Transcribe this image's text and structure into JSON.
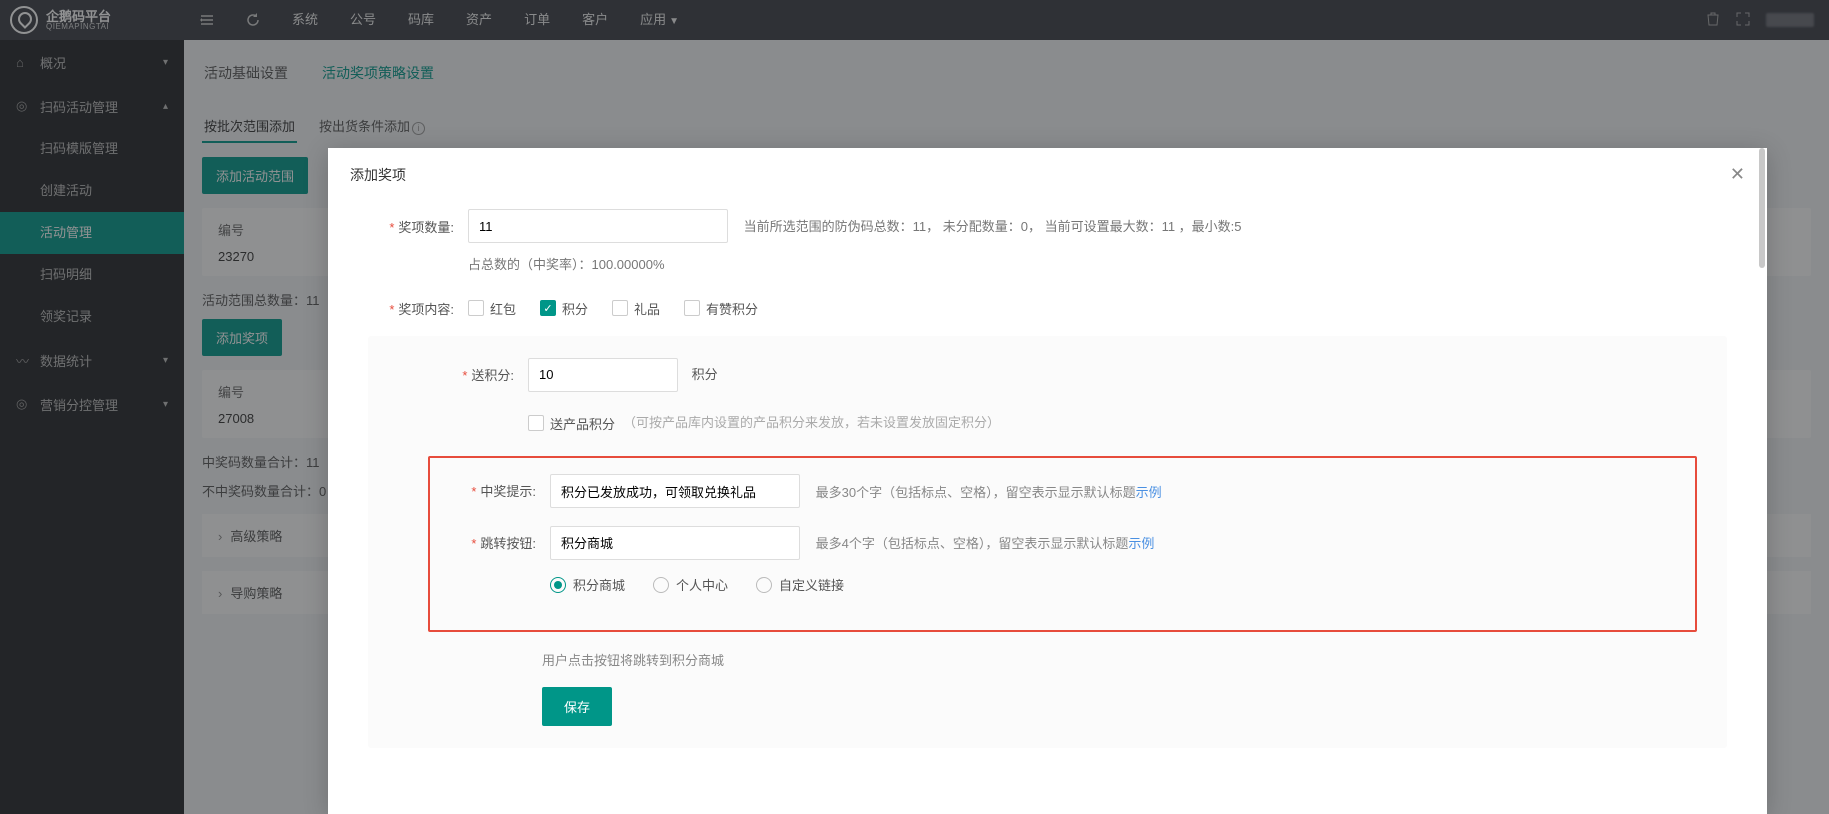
{
  "brand": {
    "cn": "企鹅码平台",
    "en": "QIEMAPINGTAI"
  },
  "topnav": {
    "items": [
      "系统",
      "公号",
      "码库",
      "资产",
      "订单",
      "客户",
      "应用"
    ]
  },
  "sidebar": {
    "overview": "概况",
    "group_scan": "扫码活动管理",
    "scan_children": [
      "扫码模版管理",
      "创建活动",
      "活动管理",
      "扫码明细",
      "领奖记录"
    ],
    "stats": "数据统计",
    "marketing": "营销分控管理"
  },
  "page": {
    "tabs": [
      "活动基础设置",
      "活动奖项策略设置"
    ],
    "subtabs": [
      "按批次范围添加",
      "按出货条件添加"
    ],
    "add_range_btn": "添加活动范围",
    "id_label": "编号",
    "id_val": "23270",
    "range_summary": "活动范围总数量：11",
    "add_prize_btn": "添加奖项",
    "id2_label": "编号",
    "id2_val": "27008",
    "win_total": "中奖码数量合计：11",
    "nowin_total": "不中奖码数量合计：0",
    "acc1": "高级策略",
    "acc2": "导购策略"
  },
  "modal": {
    "title": "添加奖项",
    "qty_label": "奖项数量:",
    "qty_value": "11",
    "qty_hint": "当前所选范围的防伪码总数：11， 未分配数量：0， 当前可设置最大数：11 ，最小数:5",
    "percent_hint": "占总数的（中奖率）：100.00000%",
    "content_label": "奖项内容:",
    "content_options": {
      "hongbao": "红包",
      "jifen": "积分",
      "lipin": "礼品",
      "youzan": "有赞积分"
    },
    "points_label": "送积分:",
    "points_value": "10",
    "points_unit": "积分",
    "product_points_cbx": "送产品积分",
    "product_points_hint": "（可按产品库内设置的产品积分来发放，若未设置发放固定积分）",
    "win_msg_label": "中奖提示:",
    "win_msg_value": "积分已发放成功，可领取兑换礼品",
    "win_msg_hint_a": "最多30个字（包括标点、空格），留空表示显示默认标题",
    "win_msg_hint_b": "示例",
    "jump_label": "跳转按钮:",
    "jump_value": "积分商城",
    "jump_hint_a": "最多4个字（包括标点、空格），留空表示显示默认标题",
    "jump_hint_b": "示例",
    "radio_options": [
      "积分商城",
      "个人中心",
      "自定义链接"
    ],
    "redirect_hint": "用户点击按钮将跳转到积分商城",
    "save_btn": "保存"
  }
}
